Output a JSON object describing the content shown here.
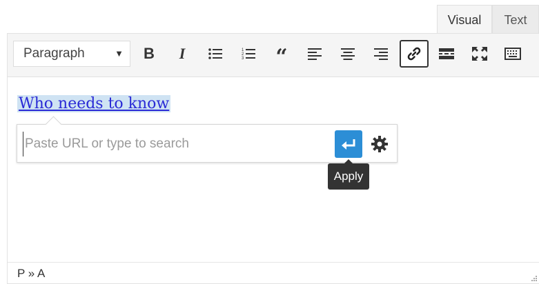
{
  "tabs": {
    "visual": "Visual",
    "text": "Text"
  },
  "toolbar": {
    "format_value": "Paragraph",
    "format_caret": "▼",
    "buttons": [
      "bold",
      "italic",
      "bulleted-list",
      "numbered-list",
      "blockquote",
      "align-left",
      "align-center",
      "align-right",
      "link",
      "read-more",
      "fullscreen",
      "toolbar-toggle"
    ]
  },
  "content": {
    "link_text": "Who needs to know"
  },
  "link_popup": {
    "placeholder": "Paste URL or type to search",
    "apply_tooltip": "Apply",
    "apply_color": "#2c8ed6"
  },
  "statusbar": {
    "path": "P » A"
  }
}
